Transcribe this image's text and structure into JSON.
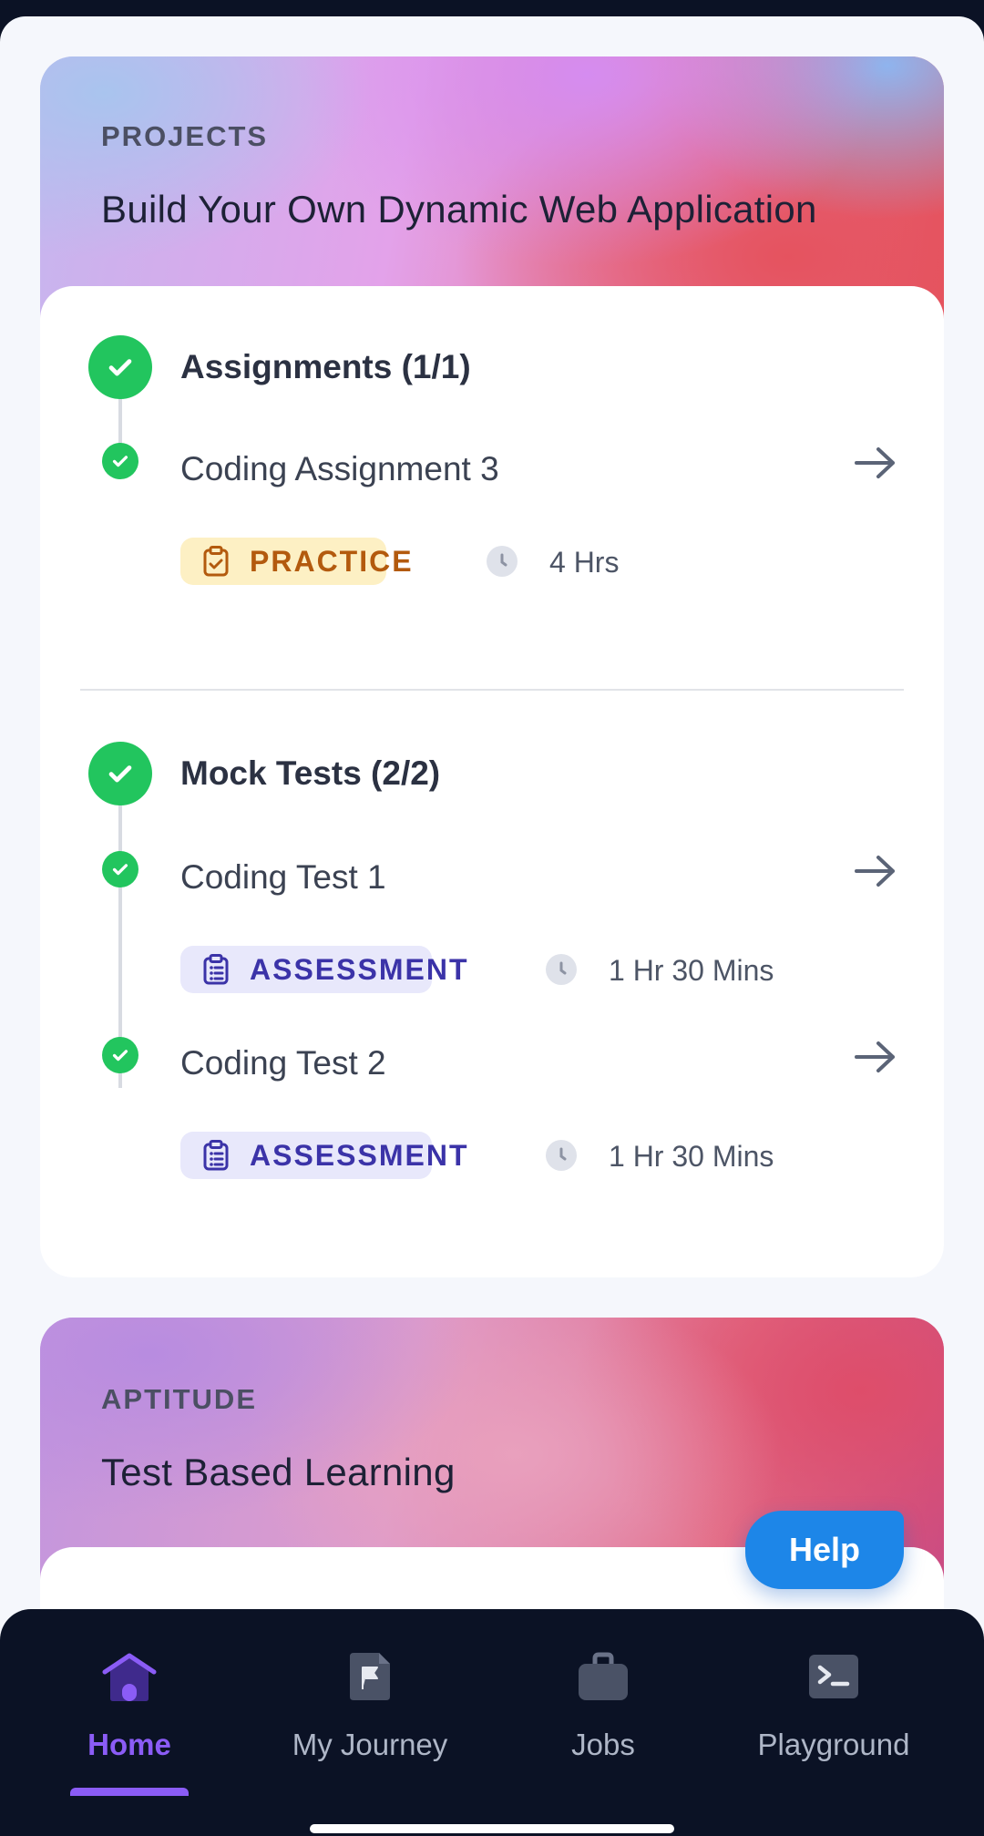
{
  "project_card": {
    "kicker": "PROJECTS",
    "title": "Build Your Own Dynamic Web Application",
    "sections": [
      {
        "title": "Assignments (1/1)",
        "items": [
          {
            "title": "Coding Assignment 3",
            "tag": "PRACTICE",
            "duration": "4 Hrs"
          }
        ]
      },
      {
        "title": "Mock Tests (2/2)",
        "items": [
          {
            "title": "Coding Test 1",
            "tag": "ASSESSMENT",
            "duration": "1 Hr 30 Mins"
          },
          {
            "title": "Coding Test 2",
            "tag": "ASSESSMENT",
            "duration": "1 Hr 30 Mins"
          }
        ]
      }
    ]
  },
  "aptitude_card": {
    "kicker": "APTITUDE",
    "title": "Test Based Learning"
  },
  "help_button": {
    "label": "Help"
  },
  "nav": {
    "items": [
      {
        "label": "Home",
        "icon": "home-icon",
        "active": true
      },
      {
        "label": "My Journey",
        "icon": "flag-icon",
        "active": false
      },
      {
        "label": "Jobs",
        "icon": "briefcase-icon",
        "active": false
      },
      {
        "label": "Playground",
        "icon": "terminal-icon",
        "active": false
      }
    ]
  },
  "colors": {
    "accent": "#8b5cf6",
    "success": "#22c55e",
    "help": "#1d86e8",
    "practice_bg": "#fdf0c4",
    "assessment_bg": "#e8e8fb"
  }
}
